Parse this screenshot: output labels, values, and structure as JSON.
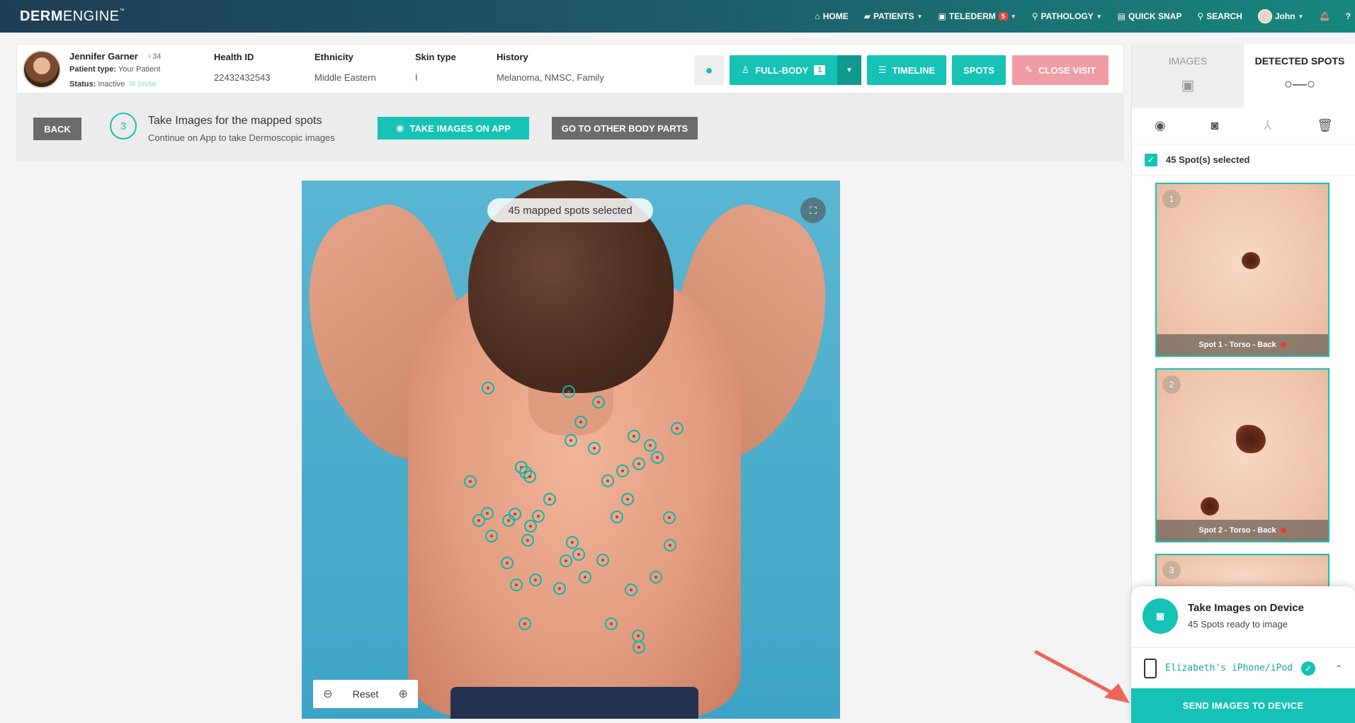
{
  "nav": {
    "logo_bold": "DERM",
    "logo_light": "ENGINE",
    "logo_tm": "™",
    "items": [
      {
        "icon": "home-icon",
        "label": "HOME"
      },
      {
        "icon": "patients-icon",
        "label": "PATIENTS"
      },
      {
        "icon": "telederm-icon",
        "label": "TELEDERM",
        "badge": "5"
      },
      {
        "icon": "microscope-icon",
        "label": "PATHOLOGY"
      },
      {
        "icon": "quick-snap-icon",
        "label": "QUICK SNAP"
      },
      {
        "icon": "search-icon",
        "label": "SEARCH"
      },
      {
        "icon": "user-avatar",
        "label": "John"
      }
    ]
  },
  "patient": {
    "name": "Jennifer Garner",
    "age": "34",
    "type_label": "Patient type:",
    "type_value": "Your Patient",
    "status_label": "Status:",
    "status_value": "Inactive",
    "invite": "Invite",
    "fields": [
      {
        "label": "Health ID",
        "value": "22432432543"
      },
      {
        "label": "Ethnicity",
        "value": "Middle Eastern"
      },
      {
        "label": "Skin type",
        "value": "I"
      },
      {
        "label": "History",
        "value": "Melanoma, NMSC, Family"
      }
    ]
  },
  "header_buttons": {
    "full_body": "FULL-BODY",
    "full_body_count": "1",
    "timeline": "TIMELINE",
    "spots": "SPOTS",
    "close_visit": "CLOSE VISIT"
  },
  "step": {
    "back": "BACK",
    "number": "3",
    "title": "Take Images for the mapped spots",
    "subtitle": "Continue on App to take Dermoscopic images",
    "take_images": "TAKE IMAGES ON APP",
    "other_parts": "GO TO OTHER BODY PARTS"
  },
  "viewer": {
    "mapped_pill": "45 mapped spots selected",
    "reset": "Reset"
  },
  "panel": {
    "tab_images": "IMAGES",
    "tab_detected": "DETECTED SPOTS",
    "selected_text": "45 Spot(s) selected",
    "thumbs": [
      {
        "num": "1",
        "caption": "Spot 1 - Torso - Back"
      },
      {
        "num": "2",
        "caption": "Spot 2 - Torso - Back"
      },
      {
        "num": "3",
        "caption": ""
      }
    ]
  },
  "device": {
    "title": "Take Images on Device",
    "subtitle": "45 Spots ready to image",
    "device_name": "Elizabeth's iPhone/iPod",
    "send": "SEND IMAGES TO DEVICE"
  },
  "colors": {
    "accent": "#15c2b5",
    "close_visit": "#ef9ca4",
    "nav_start": "#1f3e56",
    "nav_end": "#18877f"
  }
}
